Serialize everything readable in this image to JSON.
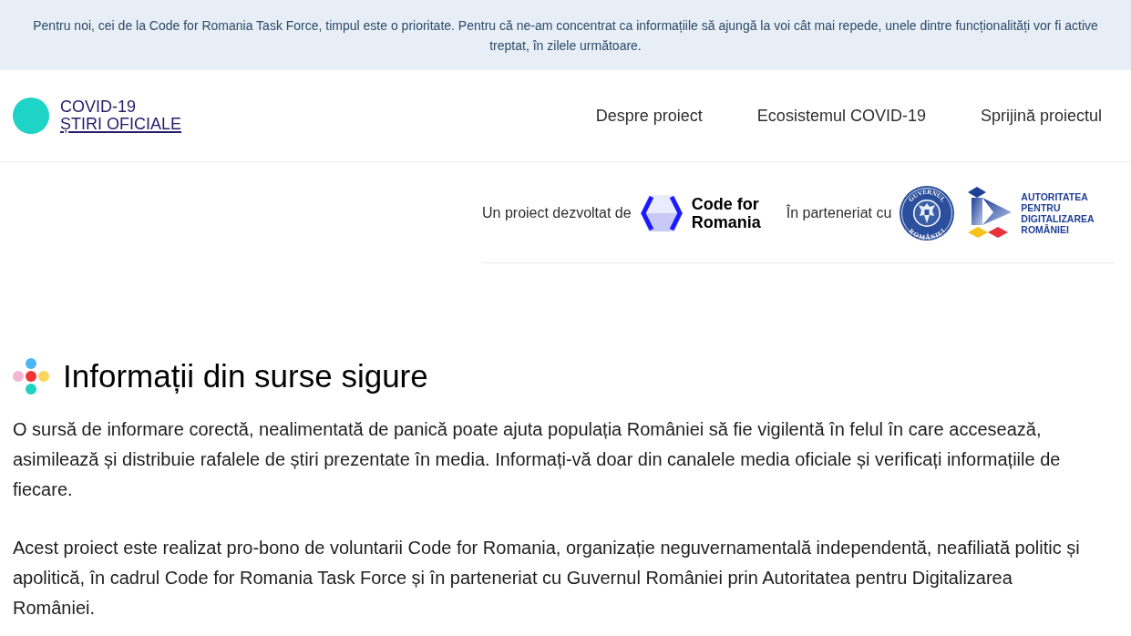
{
  "notice_banner": {
    "text": "Pentru noi, cei de la Code for Romania Task Force, timpul este o prioritate. Pentru că ne-am concentrat ca informațiile să ajungă la voi cât mai repede, unele dintre funcționalități vor fi active treptat, în zilele următoare."
  },
  "header": {
    "logo": {
      "line_1": "COVID-19",
      "line_2": "ȘTIRI OFICIALE"
    },
    "nav": [
      {
        "label": "Despre proiect"
      },
      {
        "label": "Ecosistemul COVID-19"
      },
      {
        "label": "Sprijină proiectul"
      }
    ]
  },
  "partners": {
    "developed_by": {
      "label": "Un proiect dezvoltat de",
      "logo_lines": [
        "Code for",
        "Romania"
      ]
    },
    "partnership": {
      "label": "În parteneriat cu",
      "seal_text_top": "GUVERNUL",
      "seal_text_bottom": "ROMÂNIEI",
      "authority_logo_lines": [
        "AUTORITATEA",
        "PENTRU",
        "DIGITALIZAREA",
        "ROMÂNIEI"
      ]
    }
  },
  "intro": {
    "title": "Informații din surse sigure",
    "paragraphs": [
      "O sursă de informare corectă, nealimentată de panică poate ajuta populația României să fie vigilentă în felul în care accesează, asimilează și distribuie rafalele de știri prezentate în media. Informați-vă doar din canalele media oficiale și verificați informațiile de fiecare.",
      "Acest proiect este realizat pro-bono de voluntarii Code for Romania, organizație neguvernamentală independentă, neafiliată politic și apolitică, în cadrul Code for Romania Task Force și în parteneriat cu Guvernul României prin Autoritatea pentru Digitalizarea României."
    ]
  }
}
